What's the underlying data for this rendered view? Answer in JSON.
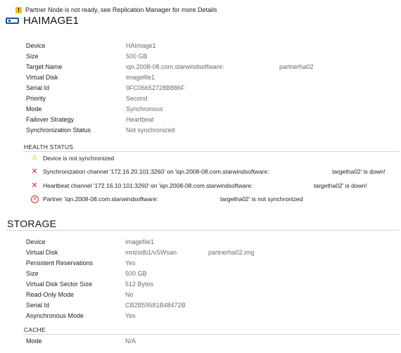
{
  "notice": {
    "icon": "warning-icon",
    "text": "Partner Node is not ready, see Replication Manager for more Details"
  },
  "device_title": {
    "icon": "device-icon",
    "text": "HAIMAGE1"
  },
  "device_props": [
    {
      "label": "Device",
      "value": "HAImage1"
    },
    {
      "label": "Size",
      "value": "500 GB"
    },
    {
      "label": "Target Name",
      "value": "iqn.2008-08.com.starwindsoftware:",
      "value2": "partnerha02"
    },
    {
      "label": "Virtual Disk",
      "value": "imagefile1"
    },
    {
      "label": "Serial Id",
      "value": "9FC06652728B886F"
    },
    {
      "label": "Priority",
      "value": "Second"
    },
    {
      "label": "Mode",
      "value": "Synchronous"
    },
    {
      "label": "Failover Strategy",
      "value": "Heartbeat"
    },
    {
      "label": "Synchronization Status",
      "value": "Not synchronized"
    }
  ],
  "health": {
    "title": "HEALTH STATUS",
    "items": [
      {
        "icon": "warning-icon",
        "text": "Device is not synchronized",
        "tail": ""
      },
      {
        "icon": "error-x-icon",
        "text": "Synchronization channel '172.16.20.101:3260' on 'iqn.2008-08.com.starwindsoftware:",
        "tail": "targetha02' is down!"
      },
      {
        "icon": "error-x-icon",
        "text": "Heartbeat channel '172.16.10.101:3260' on 'iqn.2008-08.com.starwindsoftware:",
        "tail": "targetha02' is down!"
      },
      {
        "icon": "error-circle-icon",
        "text": "Partner 'iqn.2008-08.com.starwindsoftware:",
        "tail": "targetha02' is not synchronized"
      }
    ]
  },
  "storage": {
    "title": "STORAGE",
    "props": [
      {
        "label": "Device",
        "value": "imagefile1"
      },
      {
        "label": "Virtual Disk",
        "value": "mnt/sdb1/vSWsan",
        "value2": "partnerha02.img"
      },
      {
        "label": "Persistent Reservations",
        "value": "Yes"
      },
      {
        "label": "Size",
        "value": "500 GB"
      },
      {
        "label": "Virtual Disk Sector Size",
        "value": "512 Bytes"
      },
      {
        "label": "Read-Only Mode",
        "value": "No"
      },
      {
        "label": "Serial Id",
        "value": "CB2B59581B48472B"
      },
      {
        "label": "Asynchronous Mode",
        "value": "Yes"
      }
    ]
  },
  "cache": {
    "title": "CACHE",
    "props": [
      {
        "label": "Mode",
        "value": "N/A"
      }
    ]
  },
  "colors": {
    "warning": "#f2c200",
    "error": "#d7262b",
    "device_icon": "#1e4f9c",
    "value_text": "#6b6b6b"
  }
}
